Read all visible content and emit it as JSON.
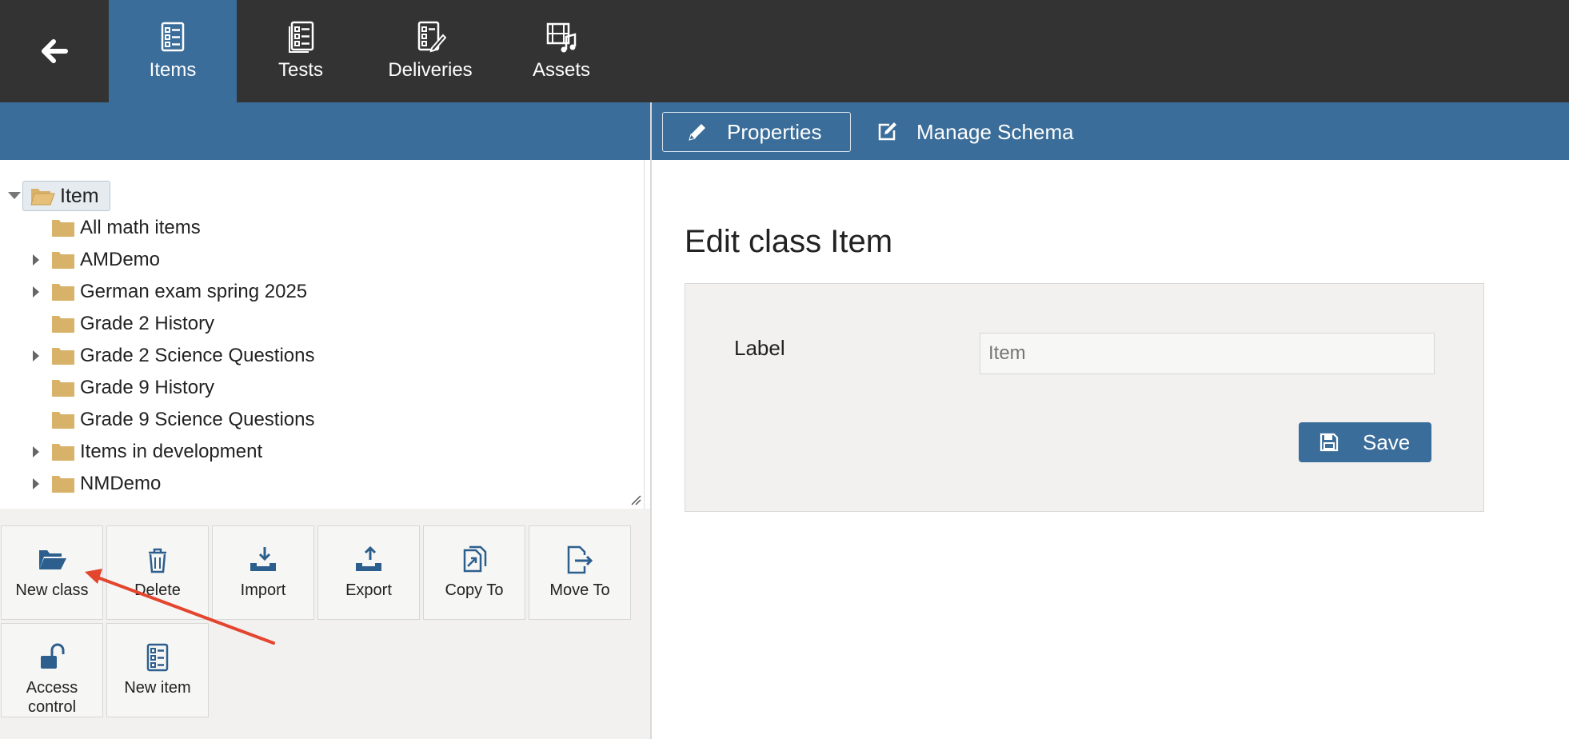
{
  "topnav": {
    "tabs": [
      {
        "label": "Items",
        "icon": "items-icon",
        "active": true
      },
      {
        "label": "Tests",
        "icon": "tests-icon",
        "active": false
      },
      {
        "label": "Deliveries",
        "icon": "deliveries-icon",
        "active": false
      },
      {
        "label": "Assets",
        "icon": "assets-icon",
        "active": false
      }
    ]
  },
  "subtabs": [
    {
      "label": "Properties",
      "icon": "pencil-icon",
      "active": true
    },
    {
      "label": "Manage Schema",
      "icon": "edit-icon",
      "active": false
    }
  ],
  "tree": {
    "root": "Item",
    "children": [
      {
        "label": "All math items",
        "expandable": false
      },
      {
        "label": "AMDemo",
        "expandable": true
      },
      {
        "label": "German exam spring 2025",
        "expandable": true
      },
      {
        "label": "Grade 2 History",
        "expandable": false
      },
      {
        "label": "Grade 2 Science Questions",
        "expandable": true
      },
      {
        "label": "Grade 9 History",
        "expandable": false
      },
      {
        "label": "Grade 9 Science Questions",
        "expandable": false
      },
      {
        "label": "Items in development",
        "expandable": true
      },
      {
        "label": "NMDemo",
        "expandable": true
      }
    ]
  },
  "actions": [
    {
      "label": "New class",
      "icon": "folder-open-icon"
    },
    {
      "label": "Delete",
      "icon": "trash-icon"
    },
    {
      "label": "Import",
      "icon": "import-icon"
    },
    {
      "label": "Export",
      "icon": "export-icon"
    },
    {
      "label": "Copy To",
      "icon": "copy-icon"
    },
    {
      "label": "Move To",
      "icon": "move-icon"
    },
    {
      "label": "Access control",
      "icon": "unlock-icon"
    },
    {
      "label": "New item",
      "icon": "new-item-icon"
    }
  ],
  "form": {
    "title": "Edit class Item",
    "label_field": "Label",
    "label_value": "Item",
    "save_label": "Save"
  },
  "colors": {
    "topbar": "#333333",
    "accent": "#3a6d99",
    "folder": "#d9b26a",
    "annotation_arrow": "#e4452f"
  }
}
